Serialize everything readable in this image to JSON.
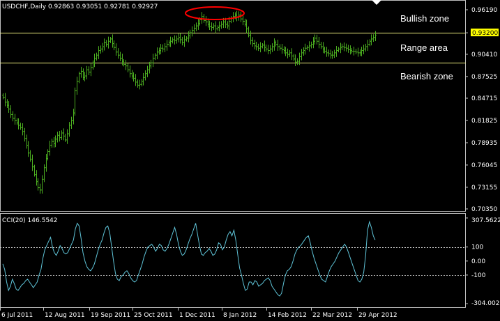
{
  "colors": {
    "background": "#000000",
    "bull": "#4caf20",
    "cci_line": "#5fc4d8",
    "level_line": "#f0f080",
    "price_label_bg": "#ffff00",
    "frame": "#c0c0c0",
    "highlight_ellipse": "#ff0000",
    "text": "#ffffff"
  },
  "price_panel": {
    "header": "USDCHF,Daily  0.92863 0.93051 0.92781 0.92927",
    "y_ticks": [
      "0.96190",
      "0.93200",
      "0.90410",
      "0.87525",
      "0.84715",
      "0.81825",
      "0.78935",
      "0.76045",
      "0.73155",
      "0.70350"
    ],
    "levels": [
      "0.93200",
      "0.89300"
    ],
    "zones": [
      "Bullish zone",
      "Range area",
      "Bearish zone"
    ]
  },
  "cci_panel": {
    "header": "CCI(20) 146.5542",
    "y_ticks": [
      "307.5622",
      "100",
      "0.00",
      "-100",
      "-304.0020"
    ]
  },
  "x_labels": [
    "6 Jul 2011",
    "12 Aug 2011",
    "19 Sep 2011",
    "25 Oct 2011",
    "1 Dec 2011",
    "8 Jan 2012",
    "14 Feb 2012",
    "22 Mar 2012",
    "29 Apr 2012"
  ],
  "chart_data": [
    {
      "type": "line",
      "title": "USDCHF,Daily",
      "ylim": [
        0.7035,
        0.9619
      ],
      "closes": [
        0.848,
        0.842,
        0.838,
        0.833,
        0.826,
        0.821,
        0.818,
        0.815,
        0.812,
        0.809,
        0.804,
        0.795,
        0.786,
        0.776,
        0.768,
        0.758,
        0.748,
        0.739,
        0.731,
        0.728,
        0.742,
        0.757,
        0.769,
        0.778,
        0.786,
        0.791,
        0.788,
        0.794,
        0.799,
        0.796,
        0.802,
        0.798,
        0.793,
        0.801,
        0.812,
        0.818,
        0.828,
        0.857,
        0.869,
        0.879,
        0.882,
        0.874,
        0.876,
        0.884,
        0.881,
        0.887,
        0.893,
        0.899,
        0.903,
        0.909,
        0.911,
        0.914,
        0.919,
        0.917,
        0.921,
        0.924,
        0.918,
        0.913,
        0.907,
        0.903,
        0.899,
        0.895,
        0.891,
        0.889,
        0.884,
        0.879,
        0.876,
        0.873,
        0.868,
        0.864,
        0.865,
        0.869,
        0.874,
        0.879,
        0.884,
        0.889,
        0.893,
        0.899,
        0.903,
        0.907,
        0.909,
        0.912,
        0.911,
        0.914,
        0.917,
        0.919,
        0.921,
        0.923,
        0.922,
        0.924,
        0.926,
        0.923,
        0.919,
        0.923,
        0.925,
        0.928,
        0.932,
        0.935,
        0.938,
        0.941,
        0.944,
        0.949,
        0.953,
        0.948,
        0.946,
        0.943,
        0.94,
        0.939,
        0.941,
        0.937,
        0.939,
        0.941,
        0.943,
        0.946,
        0.943,
        0.941,
        0.947,
        0.951,
        0.953,
        0.955,
        0.952,
        0.955,
        0.95,
        0.947,
        0.943,
        0.937,
        0.929,
        0.922,
        0.918,
        0.915,
        0.914,
        0.912,
        0.914,
        0.916,
        0.913,
        0.911,
        0.909,
        0.911,
        0.914,
        0.919,
        0.917,
        0.914,
        0.912,
        0.91,
        0.909,
        0.906,
        0.904,
        0.906,
        0.902,
        0.898,
        0.894,
        0.895,
        0.901,
        0.906,
        0.909,
        0.912,
        0.913,
        0.915,
        0.917,
        0.921,
        0.925,
        0.921,
        0.917,
        0.914,
        0.911,
        0.908,
        0.906,
        0.905,
        0.903,
        0.903,
        0.906,
        0.909,
        0.911,
        0.913,
        0.914,
        0.913,
        0.912,
        0.91,
        0.909,
        0.908,
        0.908,
        0.907,
        0.906,
        0.906,
        0.909,
        0.911,
        0.914,
        0.917,
        0.921,
        0.924,
        0.926,
        0.929
      ]
    },
    {
      "type": "line",
      "title": "CCI(20)",
      "ylim": [
        -304.002,
        307.5622
      ],
      "values": [
        -20,
        -60,
        -150,
        -210,
        -180,
        -130,
        -160,
        -200,
        -210,
        -190,
        -170,
        -160,
        -140,
        -130,
        -150,
        -170,
        -190,
        -170,
        -150,
        -100,
        -60,
        20,
        80,
        110,
        140,
        170,
        100,
        60,
        40,
        70,
        110,
        90,
        60,
        50,
        60,
        90,
        120,
        150,
        230,
        270,
        250,
        160,
        60,
        0,
        -40,
        -60,
        -70,
        -50,
        -20,
        30,
        80,
        120,
        150,
        200,
        240,
        250,
        200,
        100,
        0,
        -90,
        -130,
        -140,
        -110,
        -100,
        -80,
        -70,
        -90,
        -120,
        -140,
        -150,
        -140,
        -100,
        -60,
        -20,
        30,
        70,
        100,
        110,
        120,
        100,
        70,
        90,
        120,
        110,
        80,
        70,
        90,
        120,
        160,
        200,
        240,
        190,
        120,
        70,
        40,
        50,
        80,
        120,
        160,
        190,
        230,
        270,
        190,
        110,
        50,
        40,
        60,
        70,
        90,
        70,
        40,
        50,
        80,
        130,
        120,
        80,
        100,
        150,
        190,
        210,
        180,
        220,
        150,
        50,
        -50,
        -100,
        -160,
        -210,
        -200,
        -150,
        -150,
        -170,
        -140,
        -150,
        -180,
        -170,
        -160,
        -140,
        -130,
        -120,
        -140,
        -180,
        -200,
        -220,
        -240,
        -250,
        -230,
        -160,
        -100,
        -70,
        -60,
        -40,
        0,
        50,
        80,
        100,
        110,
        130,
        150,
        170,
        180,
        130,
        70,
        20,
        -20,
        -60,
        -100,
        -130,
        -140,
        -150,
        -110,
        -70,
        -40,
        -20,
        0,
        30,
        60,
        80,
        100,
        120,
        100,
        60,
        20,
        -20,
        -60,
        -100,
        -140,
        -150,
        -130,
        -80,
        40,
        220,
        280,
        240,
        180,
        150
      ]
    }
  ]
}
